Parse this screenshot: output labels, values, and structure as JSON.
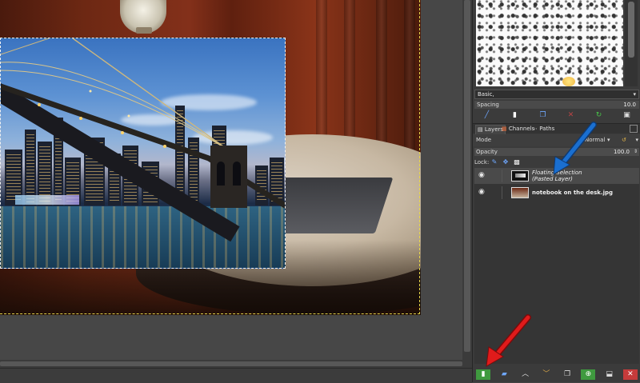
{
  "brushes": {
    "selected_brush": "Basic,",
    "spacing_label": "Spacing",
    "spacing_value": "10.0"
  },
  "layers_dock": {
    "tabs": [
      {
        "label": "Layers",
        "icon": "layers-icon"
      },
      {
        "label": "Channels",
        "icon": "channels-icon"
      },
      {
        "label": "Paths",
        "icon": "paths-icon"
      }
    ],
    "mode_label": "Mode",
    "mode_value": "Normal",
    "opacity_label": "Opacity",
    "opacity_value": "100.0",
    "lock_label": "Lock:",
    "layers": [
      {
        "name_line1": "Floating Selection",
        "name_line2": "(Pasted Layer)",
        "selected": true,
        "visible": true
      },
      {
        "name_line1": "notebook on the desk.jpg",
        "name_line2": "",
        "selected": false,
        "visible": true
      }
    ]
  },
  "annotations": {
    "blue_arrow": {
      "color": "#1a6fd0",
      "target": "floating-selection-layer"
    },
    "red_arrow": {
      "color": "#e01b1b",
      "target": "new-layer-button"
    }
  },
  "colors": {
    "dock_bg": "#3b3b3b",
    "canvas_bg": "#474747",
    "selection_border": "#e3d34a",
    "accent_green": "#3f9a3f",
    "accent_red": "#c53b3b"
  }
}
